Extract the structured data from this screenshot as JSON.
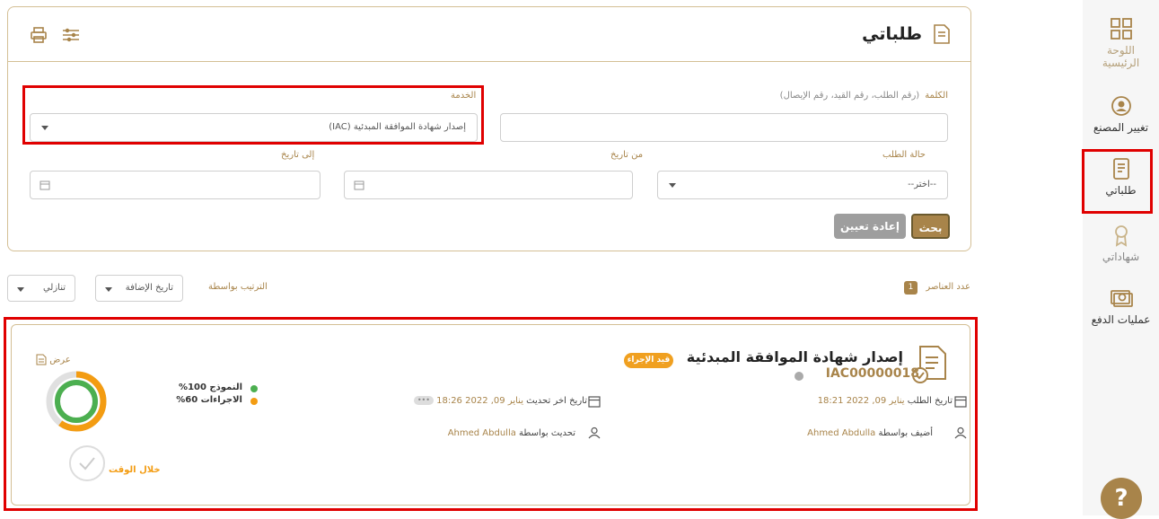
{
  "sidebar": {
    "items": [
      {
        "label": "اللوحة الرئيسية",
        "icon": "dashboard-icon"
      },
      {
        "label": "تغيير المصنع",
        "icon": "factory-switch-icon"
      },
      {
        "label": "طلباتي",
        "icon": "requests-icon"
      },
      {
        "label": "شهاداتي",
        "icon": "certificate-icon"
      },
      {
        "label": "عمليات الدفع",
        "icon": "payment-icon"
      }
    ],
    "help_label": "?"
  },
  "header": {
    "title": "طلباتي",
    "title_icon": "document-icon",
    "tools": [
      "print-icon",
      "filter-settings-icon"
    ]
  },
  "filters": {
    "keyword_label": "الكلمة",
    "keyword_hint": "(رقم الطلب، رقم القيد، رقم الإيصال)",
    "keyword_value": "",
    "service_label": "الخدمة",
    "service_value": "إصدار شهادة الموافقة المبدئية (IAC)",
    "status_label": "حالة الطلب",
    "status_value": "--اختر--",
    "from_label": "من تاريخ",
    "to_label": "إلى تاريخ",
    "search_button": "بحث",
    "reset_button": "إعادة تعيين"
  },
  "sortbar": {
    "count_label": "عدد العناصر",
    "count": "1",
    "sort_label": "الترتيب بواسطة",
    "sort_field": "تاريخ الإضافة",
    "sort_order": "تنازلي"
  },
  "request": {
    "title": "إصدار شهادة الموافقة المبدئية",
    "status": "قيد الإجراء",
    "number": "IAC00000018",
    "request_date_label": "تاريخ الطلب",
    "request_date": "يناير 09, 2022",
    "request_time": "18:21",
    "added_by_label": "أضيف بواسطة",
    "added_by": "Ahmed Abdulla",
    "last_update_label": "تاريخ اخر تحديث",
    "last_update_date": "يناير 09, 2022",
    "last_update_time": "18:26",
    "updated_by_label": "تحديث بواسطة",
    "updated_by": "Ahmed Abdulla",
    "more_label": "•••",
    "view_label": "عرض",
    "form_progress_label": "النموذج 100%",
    "form_progress": 1.0,
    "procedures_progress_label": "الاجراءات 60%",
    "procedures_progress": 0.6,
    "timeliness_label": "خلال الوقت",
    "colors": {
      "form": "#4caf50",
      "procedures": "#f39c12",
      "status": "#f0a020",
      "accent": "#a8844a"
    }
  }
}
